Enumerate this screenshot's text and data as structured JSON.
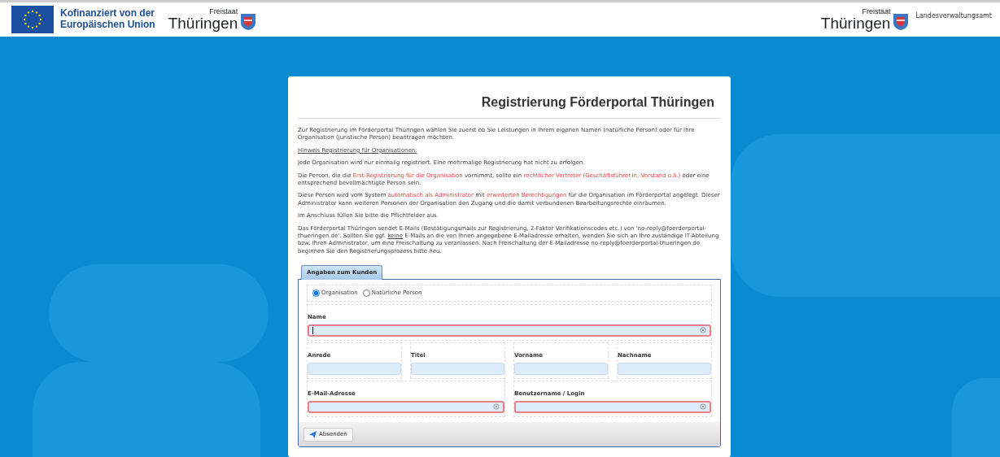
{
  "header": {
    "eu_text": [
      "Kofinanziert von der",
      "Europäischen Union"
    ],
    "state_logo": {
      "small": "Freistaat",
      "large": "Thüringen"
    },
    "right_logo": {
      "small": "Freistaat",
      "large": "Thüringen"
    },
    "agency": "Landesverwaltungsamt"
  },
  "card": {
    "title": "Registrierung Förderportal Thüringen",
    "paragraphs": [
      {
        "kind": "text",
        "segments": [
          {
            "text": "Zur Registrierung im Förderportal Thüringen wählen Sie zuerst ob Sie Leistungen in Ihrem eigenen Namen (natürliche Person) oder für Ihre Organisation (juristische Person) beantragen möchten."
          }
        ]
      },
      {
        "kind": "heading",
        "segments": [
          {
            "text": "Hinweis Registrierung für Organisationen:"
          }
        ]
      },
      {
        "kind": "text",
        "segments": [
          {
            "text": "Jede Organisation wird nur einmalig registriert. Eine mehrmalige Registrierung hat nicht zu erfolgen."
          }
        ]
      },
      {
        "kind": "text",
        "segments": [
          {
            "text": "Die Person, die die "
          },
          {
            "text": "Erst-Registrierung für die Organisation",
            "highlight": true
          },
          {
            "text": " vornimmt, sollte ein "
          },
          {
            "text": "rechtlicher Vertreter (Geschäftsführer.in, Vorstand o.ä.)",
            "highlight": true
          },
          {
            "text": " oder eine entsprechend bevollmächtigte Person sein."
          }
        ]
      },
      {
        "kind": "text",
        "segments": [
          {
            "text": "Diese Person wird vom System "
          },
          {
            "text": "automatisch als Administrator",
            "highlight": true
          },
          {
            "text": " mit "
          },
          {
            "text": "erweiterten Berechtigungen",
            "highlight": true
          },
          {
            "text": " für die Organisation im Förderportal angelegt. Dieser Administrator kann weiteren Personen der Organisation den Zugang und die damit verbundenen Bearbeitungsrechte einräumen."
          }
        ]
      },
      {
        "kind": "text",
        "segments": [
          {
            "text": "Im Anschluss füllen Sie bitte die Pflichtfelder aus."
          }
        ]
      },
      {
        "kind": "text",
        "segments": [
          {
            "text": "Das Förderportal Thüringen sendet E-Mails (Bestätigungsmails zur Registrierung, 2-Faktor Verifikationscodes etc.) von 'no-reply@foerderportal-thueringen.de'. Sollten Sie ggf. "
          },
          {
            "text": "keine",
            "underline": true
          },
          {
            "text": " E-Mails an die von Ihnen angegebene E-Mailadresse erhalten, wenden Sie sich an Ihre zuständige IT-Abteilung bzw. Ihren Administrator, um eine Freischaltung zu veranlassen. Nach Freischaltung der E-Mailadresse no-reply@foerderportal-thueringen.de beginnen Sie den Registrierungsprozess bitte neu."
          }
        ]
      }
    ],
    "form": {
      "tab": "Angaben zum Kunden",
      "customer_type": [
        {
          "label": "Organisation",
          "selected": true
        },
        {
          "label": "Natürliche Person",
          "selected": false
        }
      ],
      "field_rows": [
        [
          {
            "label": "Name",
            "required": true,
            "focused": true
          }
        ],
        [
          {
            "label": "Anrede",
            "required": false,
            "focused": false
          },
          {
            "label": "Titel",
            "required": false,
            "focused": false
          },
          {
            "label": "Vorname",
            "required": false,
            "focused": false
          },
          {
            "label": "Nachname",
            "required": false,
            "focused": false
          }
        ],
        [
          {
            "label": "E-Mail-Adresse",
            "required": true,
            "focused": false
          },
          {
            "label": "Benutzername / Login",
            "required": true,
            "focused": false
          }
        ]
      ],
      "submit": "Absenden"
    }
  }
}
